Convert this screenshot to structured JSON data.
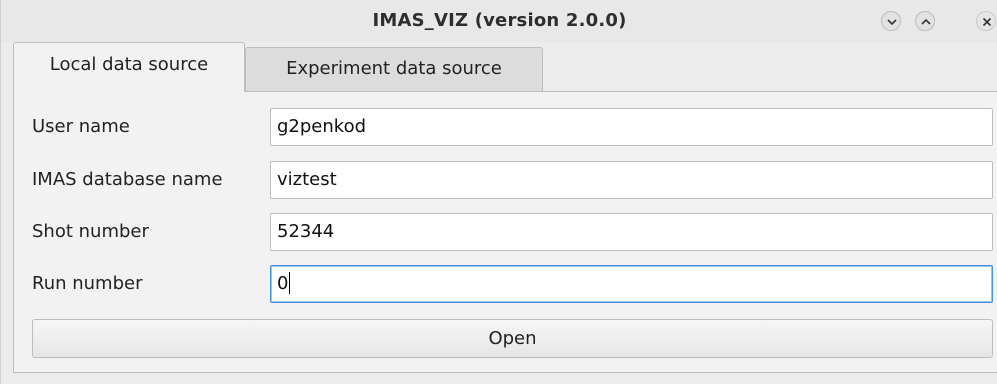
{
  "window": {
    "title": "IMAS_VIZ (version 2.0.0)"
  },
  "tabs": [
    {
      "label": "Local data source",
      "selected": true
    },
    {
      "label": "Experiment data source",
      "selected": false
    }
  ],
  "form": {
    "fields": [
      {
        "label": "User name",
        "value": "g2penkod"
      },
      {
        "label": "IMAS database name",
        "value": "viztest"
      },
      {
        "label": "Shot number",
        "value": "52344"
      },
      {
        "label": "Run number",
        "value": "0"
      }
    ],
    "open_label": "Open"
  },
  "icons": {
    "minimize": "chevron-down-icon",
    "maximize": "chevron-up-icon",
    "close": "close-icon"
  }
}
